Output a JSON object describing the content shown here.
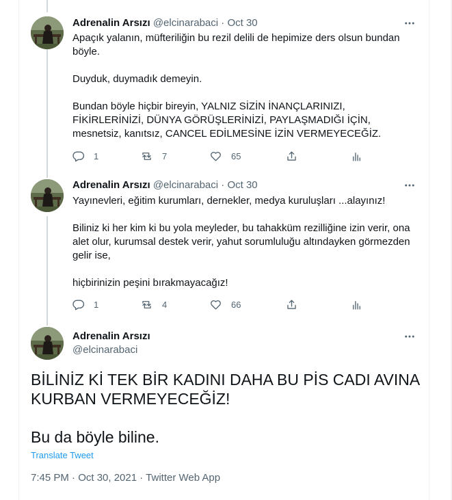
{
  "author": {
    "name": "Adrenalin Arsızı",
    "handle": "@elcinarabaci"
  },
  "tweets": [
    {
      "date": "Oct 30",
      "paragraphs": [
        "Apaçık yalanın, müfteriliğin bu rezil delili de hepimize ders olsun bundan böyle.",
        "Duyduk, duymadık demeyin.",
        "Bundan böyle hiçbir bireyin, YALNIZ SİZİN İNANÇLARINIZI, FİKİRLERİNİZİ, DÜNYA GÖRÜŞLERİNİZİ, PAYLAŞMADIĞI İÇİN, mesnetsiz, kanıtsız, CANCEL EDİLMESİNE İZİN VERMEYECEĞİZ."
      ],
      "replies": "1",
      "retweets": "7",
      "likes": "65"
    },
    {
      "date": "Oct 30",
      "paragraphs": [
        "Yayınevleri, eğitim kurumları, dernekler, medya kuruluşları ...alayınız!",
        "Biliniz ki her kim ki bu yola meyleder, bu tahakküm rezilliğine izin verir, ona alet olur, kurumsal destek verir, yahut sorumluluğu altındayken görmezden gelir ise,",
        "hiçbirinizin peşini bırakmayacağız!"
      ],
      "replies": "1",
      "retweets": "4",
      "likes": "66"
    }
  ],
  "main_tweet": {
    "paragraphs": [
      "BİLİNİZ Kİ TEK BİR KADINI DAHA BU PİS CADI AVINA KURBAN VERMEYECEĞİZ!",
      "Bu da böyle biline."
    ],
    "translate_label": "Translate Tweet",
    "time": "7:45 PM · Oct 30, 2021",
    "separator": " · ",
    "source": "Twitter Web App"
  },
  "icons": {
    "more": "more-horizontal-icon",
    "reply": "reply-icon",
    "retweet": "retweet-icon",
    "like": "heart-icon",
    "share": "share-icon",
    "analytics": "analytics-icon"
  },
  "colors": {
    "text": "#0f1419",
    "secondary": "#536471",
    "link": "#1d9bf0",
    "thread_line": "#cfd9de"
  }
}
